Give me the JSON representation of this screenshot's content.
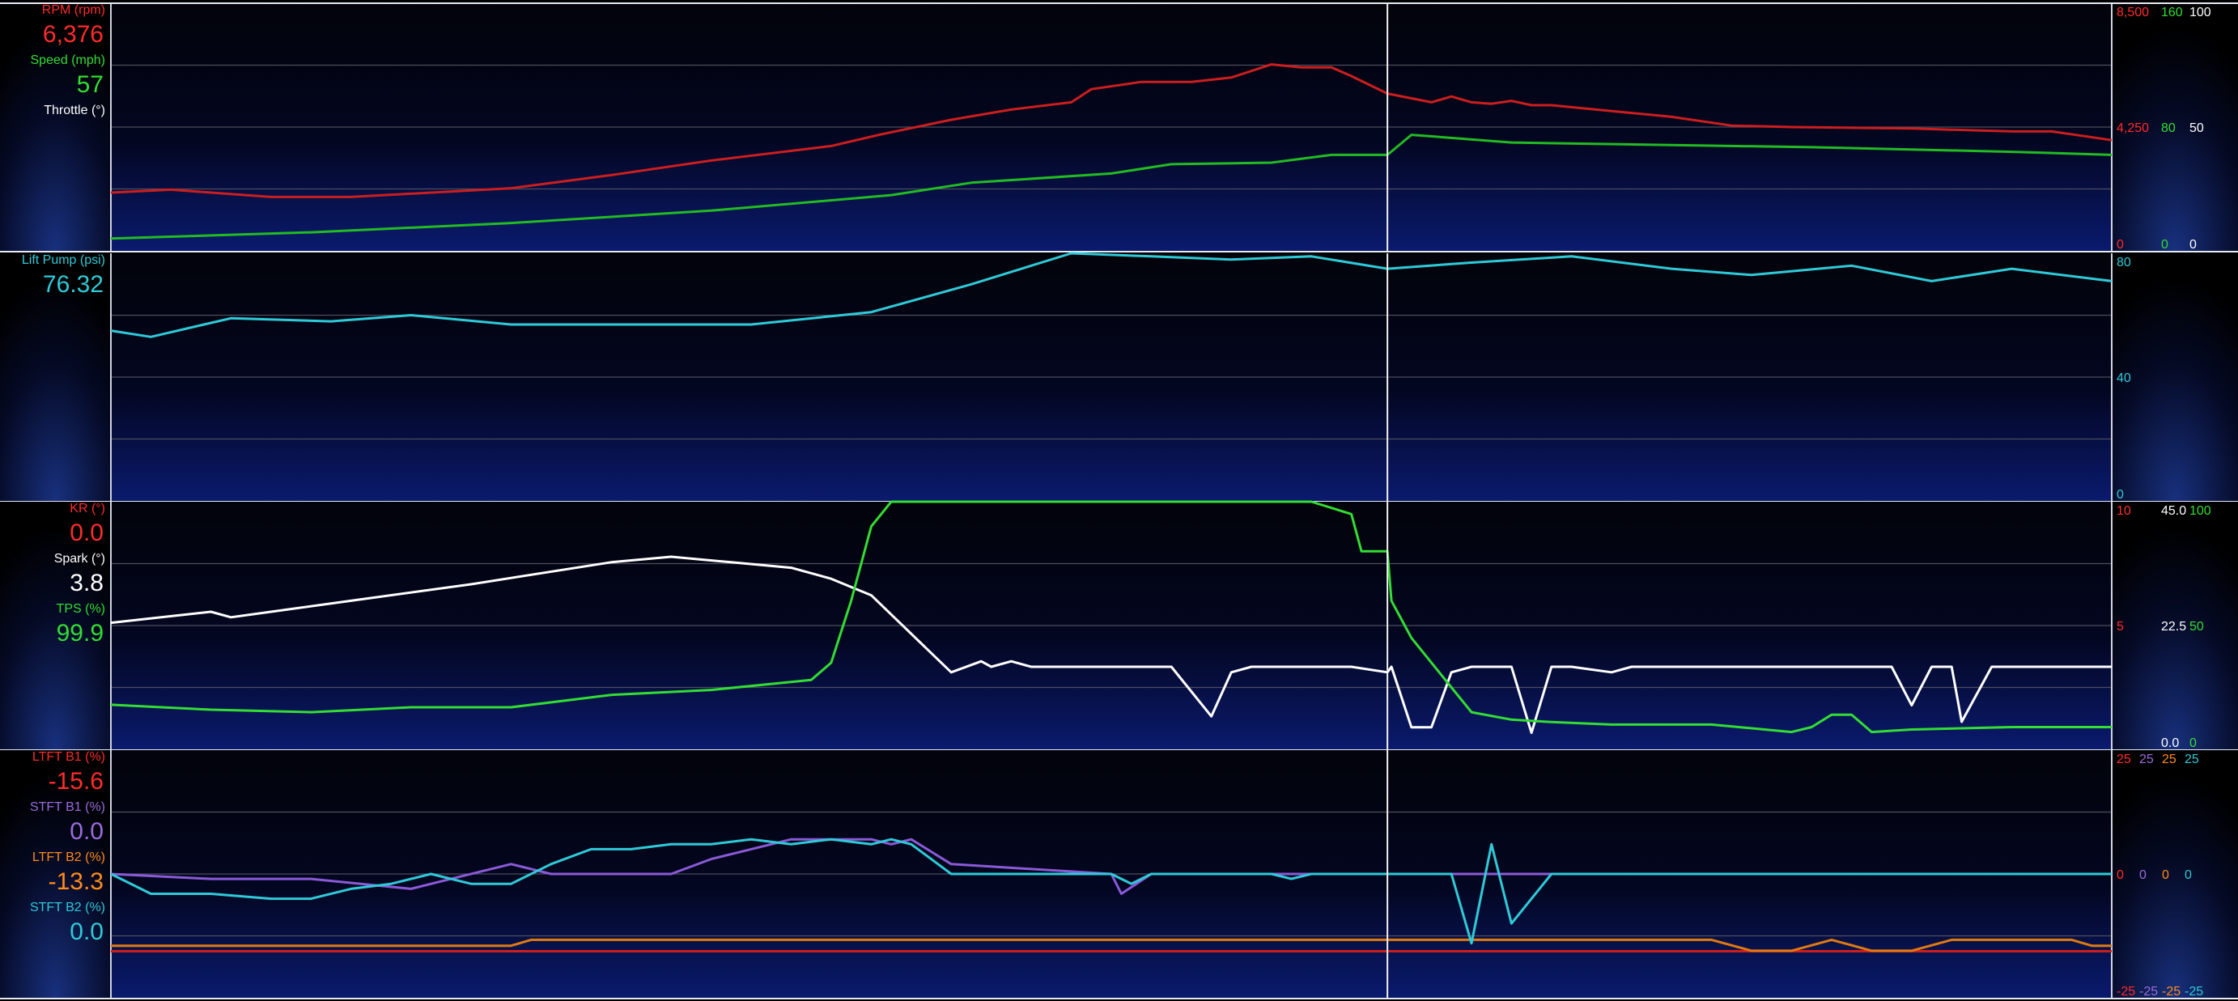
{
  "chart_data": [
    {
      "type": "line",
      "x_range": [
        0,
        100
      ],
      "cursor_x": 63.8,
      "left_labels": [
        {
          "name": "RPM (rpm)",
          "value": "6,376",
          "color": "#ff2b2b"
        },
        {
          "name": "Speed (mph)",
          "value": "57",
          "color": "#33dd33"
        },
        {
          "name": "Throttle (°)",
          "value": "",
          "color": "#ffffff"
        }
      ],
      "right_scales": [
        {
          "color": "#ff2b2b",
          "max": "8,500",
          "mid": "4,250",
          "min": "0"
        },
        {
          "color": "#33dd33",
          "max": "160",
          "mid": "80",
          "min": "0"
        },
        {
          "color": "#ffffff",
          "max": "100",
          "mid": "50",
          "min": "0"
        }
      ],
      "series": [
        {
          "name": "RPM (rpm)",
          "color": "#cc1e1e",
          "ylim": [
            0,
            8500
          ],
          "x": [
            0,
            3,
            8,
            12,
            20,
            25,
            30,
            36,
            38.5,
            42,
            45,
            48,
            49,
            51.5,
            54,
            56,
            58,
            59.5,
            61,
            62,
            63.8,
            66,
            67,
            68,
            69,
            70,
            71,
            72,
            75,
            78,
            81,
            84,
            90,
            95,
            97,
            100
          ],
          "y": [
            2000,
            2100,
            1850,
            1850,
            2150,
            2600,
            3100,
            3600,
            4000,
            4500,
            4850,
            5100,
            5550,
            5800,
            5800,
            5950,
            6400,
            6300,
            6300,
            6000,
            5400,
            5100,
            5300,
            5100,
            5050,
            5150,
            5000,
            5000,
            4800,
            4600,
            4300,
            4250,
            4200,
            4100,
            4100,
            3800
          ]
        },
        {
          "name": "Speed (mph)",
          "color": "#22bb22",
          "ylim": [
            0,
            160
          ],
          "x": [
            0,
            10,
            20,
            30,
            39,
            43,
            50,
            53,
            58,
            61,
            63.8,
            65,
            70,
            80,
            85,
            95,
            100
          ],
          "y": [
            8,
            12,
            18,
            26,
            36,
            44,
            50,
            56,
            57,
            62,
            62,
            75,
            70,
            68,
            67,
            64,
            62
          ]
        }
      ]
    },
    {
      "type": "line",
      "x_range": [
        0,
        100
      ],
      "cursor_x": 63.8,
      "left_labels": [
        {
          "name": "Lift Pump (psi)",
          "value": "76.32",
          "color": "#2fcad8"
        }
      ],
      "right_scales": [
        {
          "color": "#2fcad8",
          "max": "80",
          "mid": "40",
          "min": "0"
        }
      ],
      "series": [
        {
          "name": "Lift Pump (psi)",
          "color": "#2fcad8",
          "ylim": [
            0,
            80
          ],
          "x": [
            0,
            2,
            6,
            11,
            15,
            20,
            28,
            32,
            38,
            43,
            48,
            52,
            56,
            60,
            63.8,
            68,
            73,
            78,
            82,
            87,
            91,
            95,
            100
          ],
          "y": [
            55,
            53,
            59,
            58,
            60,
            57,
            57,
            57,
            61,
            70,
            80,
            79,
            78,
            79,
            75,
            77,
            79,
            75,
            73,
            76,
            71,
            75,
            71
          ]
        }
      ]
    },
    {
      "type": "line",
      "x_range": [
        0,
        100
      ],
      "cursor_x": 63.8,
      "left_labels": [
        {
          "name": "KR (°)",
          "value": "0.0",
          "color": "#ff2b2b"
        },
        {
          "name": "Spark (°)",
          "value": "3.8",
          "color": "#ffffff"
        },
        {
          "name": "TPS (%)",
          "value": "99.9",
          "color": "#33dd33"
        }
      ],
      "right_scales": [
        {
          "color": "#ff2b2b",
          "max": "10",
          "mid": "5",
          "min": ""
        },
        {
          "color": "#ffffff",
          "max": "45.0",
          "mid": "22.5",
          "min": "0.0"
        },
        {
          "color": "#33dd33",
          "max": "100",
          "mid": "50",
          "min": "0"
        }
      ],
      "series": [
        {
          "name": "Spark (°)",
          "color": "#ffffff",
          "ylim": [
            0,
            45
          ],
          "x": [
            0,
            5,
            6,
            8,
            12,
            18,
            25,
            28,
            31,
            34,
            36,
            38,
            42,
            43.5,
            44,
            45,
            46,
            48,
            50,
            53,
            55,
            56,
            57,
            59,
            61,
            62,
            63.8,
            64,
            65,
            66,
            67,
            68,
            69,
            70,
            71,
            72,
            73,
            75,
            76,
            77,
            80,
            82,
            85,
            88,
            89,
            90,
            91,
            92,
            92.5,
            94,
            94.5,
            96,
            98,
            99,
            100
          ],
          "y": [
            23,
            25,
            24,
            25,
            27,
            30,
            34,
            35,
            34,
            33,
            31,
            28,
            14,
            16,
            15,
            16,
            15,
            15,
            15,
            15,
            6,
            14,
            15,
            15,
            15,
            15,
            14,
            15,
            4,
            4,
            14,
            15,
            15,
            15,
            3,
            15,
            15,
            14,
            15,
            15,
            15,
            15,
            15,
            15,
            15,
            8,
            15,
            15,
            5,
            15,
            15,
            15,
            15,
            15,
            15
          ]
        },
        {
          "name": "TPS (%)",
          "color": "#33dd33",
          "ylim": [
            0,
            100
          ],
          "x": [
            0,
            5,
            10,
            15,
            20,
            25,
            30,
            35,
            36,
            37,
            38,
            39,
            40,
            41,
            42,
            50,
            55,
            60,
            62,
            62.5,
            63.8,
            64,
            65,
            66,
            67,
            68,
            70,
            72,
            75,
            80,
            84,
            85,
            86,
            87,
            88,
            90,
            95,
            100
          ],
          "y": [
            18,
            16,
            15,
            17,
            17,
            22,
            24,
            28,
            35,
            60,
            90,
            100,
            100,
            100,
            100,
            100,
            100,
            100,
            95,
            80,
            80,
            60,
            45,
            35,
            25,
            15,
            12,
            11,
            10,
            10,
            7,
            9,
            14,
            14,
            7,
            8,
            9,
            9
          ]
        }
      ]
    },
    {
      "type": "line",
      "x_range": [
        0,
        100
      ],
      "cursor_x": 63.8,
      "left_labels": [
        {
          "name": "LTFT B1 (%)",
          "value": "-15.6",
          "color": "#ff2b2b"
        },
        {
          "name": "STFT B1 (%)",
          "value": "0.0",
          "color": "#9b6bdd"
        },
        {
          "name": "LTFT B2 (%)",
          "value": "-13.3",
          "color": "#ff8c1a"
        },
        {
          "name": "STFT B2 (%)",
          "value": "0.0",
          "color": "#2fcad8"
        }
      ],
      "right_scales": [
        {
          "color": "#ff2b2b",
          "max": "25",
          "mid": "0",
          "min": "-25"
        },
        {
          "color": "#9b6bdd",
          "max": "25",
          "mid": "0",
          "min": "-25"
        },
        {
          "color": "#ff8c1a",
          "max": "25",
          "mid": "0",
          "min": "-25"
        },
        {
          "color": "#2fcad8",
          "max": "25",
          "mid": "0",
          "min": "-25"
        }
      ],
      "series": [
        {
          "name": "LTFT B1 (%)",
          "color": "#cc1e1e",
          "ylim": [
            -25,
            25
          ],
          "x": [
            0,
            20,
            21,
            70,
            71,
            80,
            81,
            100
          ],
          "y": [
            -15.6,
            -15.6,
            -15.6,
            -15.6,
            -15.6,
            -15.6,
            -15.6,
            -15.6
          ]
        },
        {
          "name": "LTFT B2 (%)",
          "color": "#e07a10",
          "ylim": [
            -25,
            25
          ],
          "x": [
            0,
            20,
            21,
            70,
            80,
            82,
            84,
            86,
            88,
            90,
            92,
            94,
            98,
            99,
            100
          ],
          "y": [
            -14.5,
            -14.5,
            -13.3,
            -13.3,
            -13.3,
            -15.5,
            -15.5,
            -13.3,
            -15.5,
            -15.5,
            -13.3,
            -13.3,
            -13.3,
            -14.5,
            -14.5
          ]
        },
        {
          "name": "STFT B1 (%)",
          "color": "#8a5ad8",
          "ylim": [
            -25,
            25
          ],
          "x": [
            0,
            5,
            10,
            15,
            17,
            20,
            22,
            25,
            28,
            30,
            32,
            34,
            36,
            38,
            39,
            40,
            42,
            50,
            50.5,
            52,
            60,
            62,
            64,
            66,
            67.5,
            68,
            70,
            72,
            80,
            90,
            100
          ],
          "y": [
            0,
            -1,
            -1,
            -3,
            -1,
            2,
            0,
            0,
            0,
            3,
            5,
            7,
            7,
            7,
            6,
            7,
            2,
            0,
            -4,
            0,
            0,
            0,
            0,
            0,
            0,
            0,
            0,
            0,
            0,
            0,
            0
          ]
        },
        {
          "name": "STFT B2 (%)",
          "color": "#2fcad8",
          "ylim": [
            -25,
            25
          ],
          "x": [
            0,
            2,
            5,
            8,
            10,
            12,
            14,
            16,
            18,
            20,
            22,
            24,
            26,
            28,
            30,
            32,
            34,
            36,
            38,
            39,
            40,
            41,
            42,
            50,
            51,
            52,
            58,
            59,
            60,
            62,
            64,
            66,
            67,
            68,
            69,
            70,
            72,
            80,
            90,
            100
          ],
          "y": [
            0,
            -4,
            -4,
            -5,
            -5,
            -3,
            -2,
            0,
            -2,
            -2,
            2,
            5,
            5,
            6,
            6,
            7,
            6,
            7,
            6,
            7,
            6,
            3,
            0,
            0,
            -2,
            0,
            0,
            -1,
            0,
            0,
            0,
            0,
            0,
            -14,
            6,
            -10,
            0,
            0,
            0,
            0
          ]
        }
      ]
    }
  ]
}
